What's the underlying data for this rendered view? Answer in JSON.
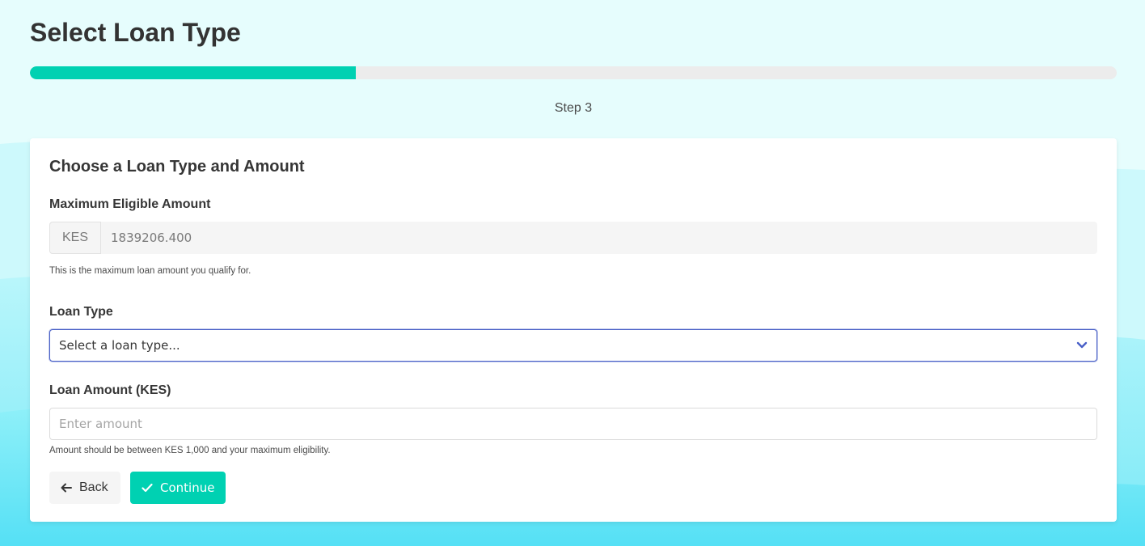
{
  "header": {
    "title": "Select Loan Type"
  },
  "progress": {
    "percent": 30,
    "step_label": "Step 3"
  },
  "card": {
    "title": "Choose a Loan Type and Amount",
    "max_amount": {
      "label": "Maximum Eligible Amount",
      "currency": "KES",
      "value": "1839206.400",
      "help": "This is the maximum loan amount you qualify for."
    },
    "loan_type": {
      "label": "Loan Type",
      "selected": "Select a loan type..."
    },
    "loan_amount": {
      "label": "Loan Amount (KES)",
      "placeholder": "Enter amount",
      "help": "Amount should be between KES 1,000 and your maximum eligibility."
    },
    "actions": {
      "back_label": "Back",
      "continue_label": "Continue"
    }
  },
  "colors": {
    "accent": "#00d1b2",
    "focus_border": "#485fc7",
    "background": "#e4fdfd"
  },
  "icons": {
    "select": "chevron-down-icon",
    "back": "arrow-left-icon",
    "continue": "check-icon"
  }
}
